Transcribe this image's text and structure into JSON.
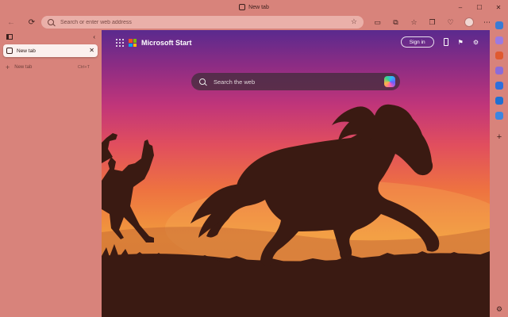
{
  "window": {
    "title": "New tab",
    "controls": {
      "minimize": "–",
      "maximize": "☐",
      "close": "✕"
    }
  },
  "toolbar": {
    "back_icon": "←",
    "refresh_icon": "⟳",
    "address_placeholder": "Search or enter web address",
    "favorite_icon": "☆",
    "icons": [
      "split-screen-icon",
      "extensions-icon",
      "favorites-icon",
      "collections-icon",
      "performance-icon",
      "profile-icon",
      "more-icon"
    ]
  },
  "tabpane": {
    "collapse_icon": "‹",
    "active_tab": {
      "label": "New tab",
      "close_icon": "✕"
    },
    "new_tab": {
      "plus": "+",
      "label": "New tab",
      "shortcut": "Ctrl+T"
    }
  },
  "content": {
    "brand": "Microsoft Start",
    "signin_label": "Sign in",
    "search_placeholder": "Search the web"
  },
  "sidebar": {
    "icon_colors": [
      "#3a7bd5",
      "#9c7ae0",
      "#e05a30",
      "#8c6bd8",
      "#2f6fdd",
      "#1f6fd1",
      "#3d86e0"
    ],
    "add_icon": "+",
    "settings_icon": "⚙"
  },
  "colors": {
    "accent_bg": "#d8837b",
    "address_bg": "#eab0a9"
  }
}
